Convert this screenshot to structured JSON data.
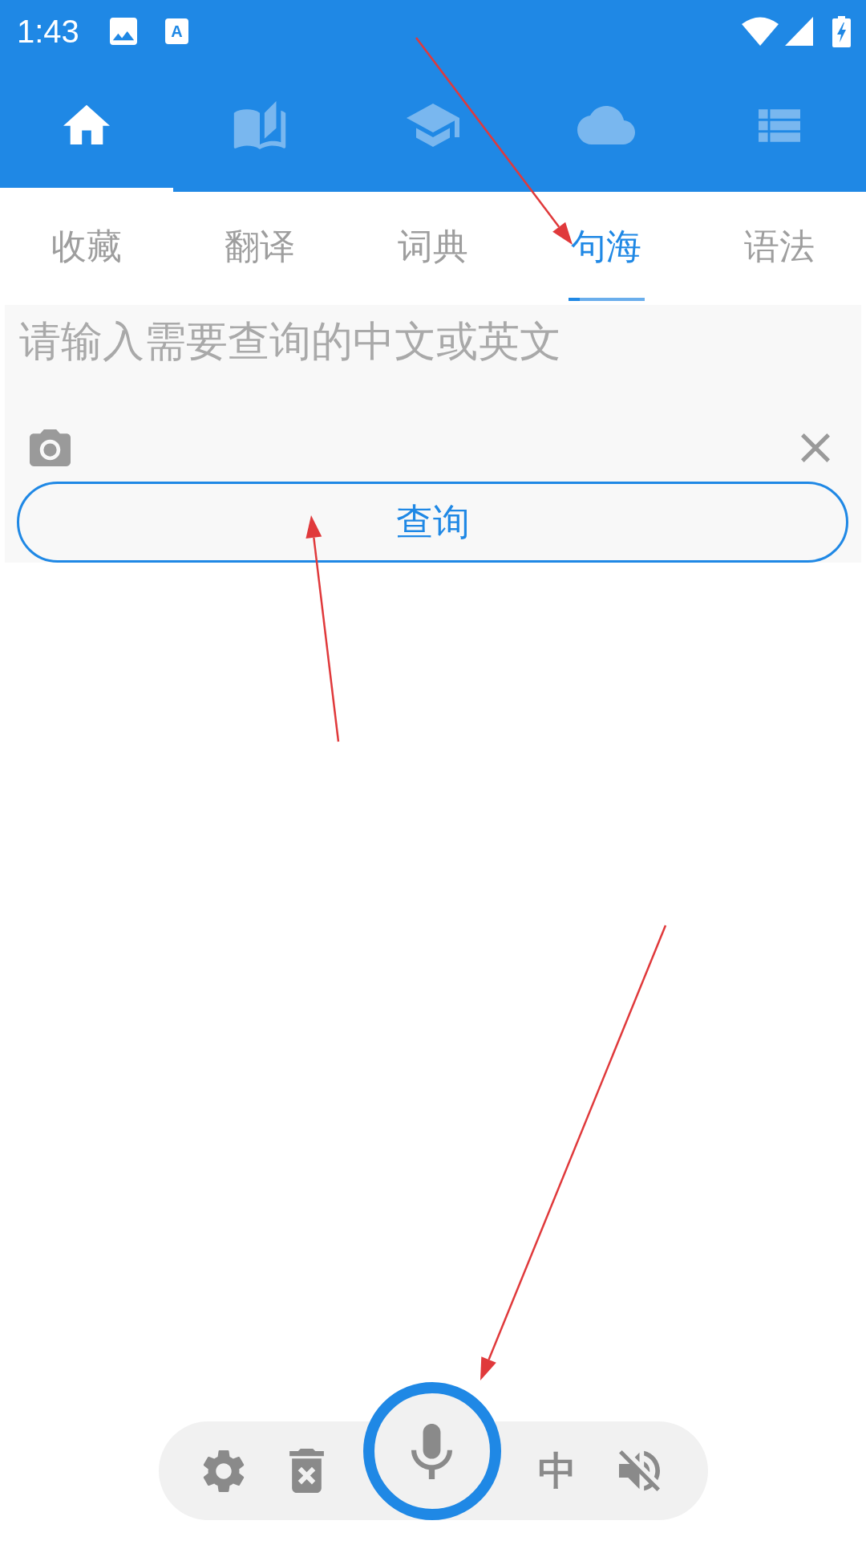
{
  "status_bar": {
    "time": "1:43",
    "notification_badge": "A"
  },
  "nav_tabs": [
    {
      "selected": true
    },
    {
      "selected": false
    },
    {
      "selected": false
    },
    {
      "selected": false
    },
    {
      "selected": false
    }
  ],
  "sub_tabs": [
    {
      "label": "收藏",
      "selected": false
    },
    {
      "label": "翻译",
      "selected": false
    },
    {
      "label": "词典",
      "selected": false
    },
    {
      "label": "句海",
      "selected": true
    },
    {
      "label": "语法",
      "selected": false
    }
  ],
  "search": {
    "placeholder": "请输入需要查询的中文或英文",
    "button": "查询"
  },
  "voice_bar": {
    "language": "中",
    "sound_muted": true
  }
}
